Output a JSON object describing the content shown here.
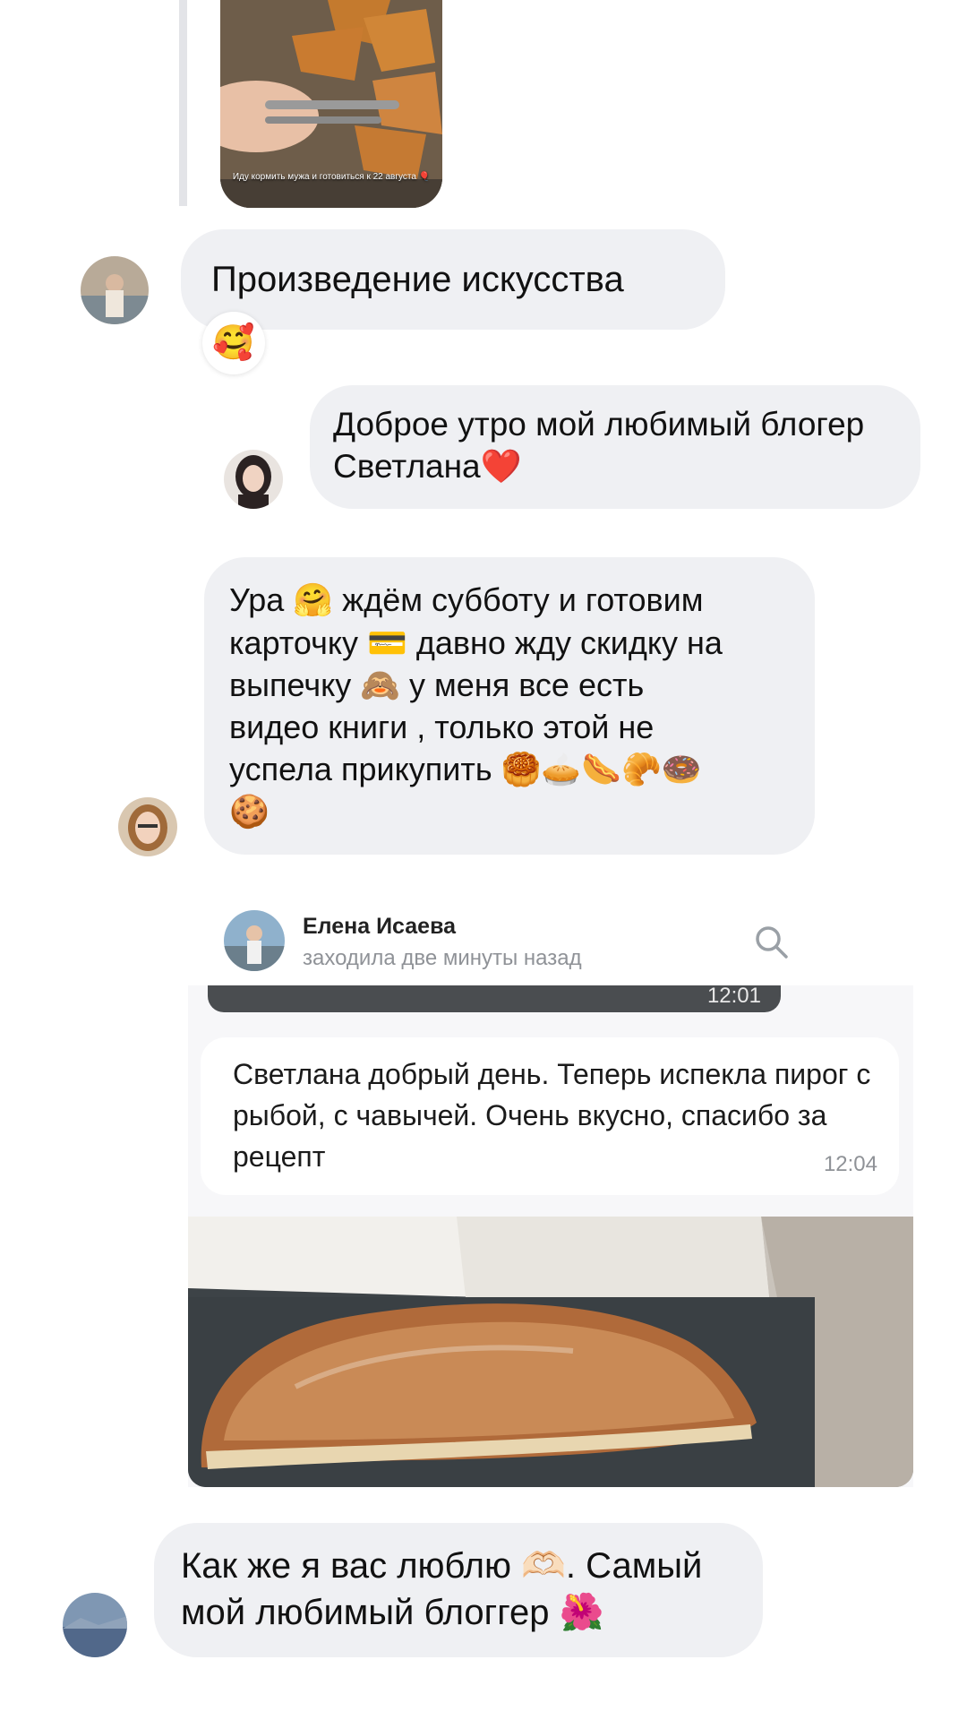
{
  "story": {
    "caption": "Иду кормить мужа и готовиться к 22 августа 🎈"
  },
  "messages": [
    {
      "id": "m1",
      "text": "Произведение искусства",
      "reaction": "🥰"
    },
    {
      "id": "m2",
      "text_line1": "Доброе утро мой любимый блогер",
      "text_line2": "Светлана❤️"
    },
    {
      "id": "m3",
      "lines": [
        "Ура 🤗 ждём субботу и готовим",
        "карточку 💳 давно жду скидку на",
        "выпечку 🙈 у меня все есть",
        "видео книги , только этой не",
        "успела прикупить 🥮🥧🌭🥐🍩",
        "🍪"
      ]
    },
    {
      "id": "m5",
      "text_line1": "Как же я вас люблю 🫶🏻. Самый",
      "text_line2": "мой любимый блоггер 🌺"
    }
  ],
  "forwarded_screenshot": {
    "contact_name": "Елена Исаева",
    "contact_status": "заходила две минуты назад",
    "prev_time": "12:01",
    "message": "Светлана добрый день. Теперь испекла пирог с рыбой, с чавычей. Очень вкусно, спасибо за рецепт",
    "time": "12:04"
  }
}
